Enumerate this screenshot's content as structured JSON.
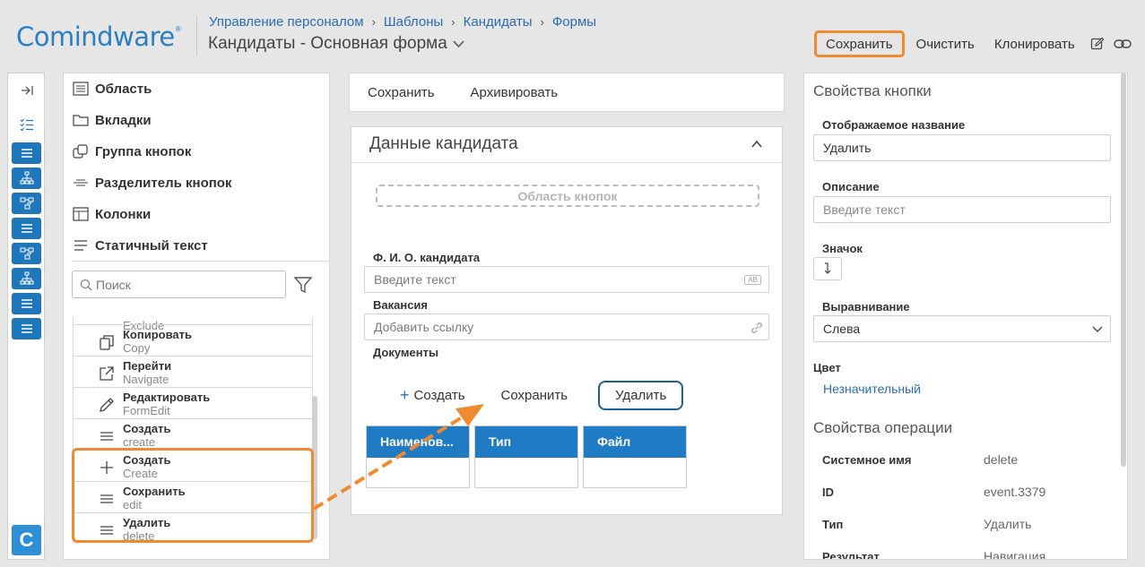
{
  "app": {
    "logo": "Comindware",
    "logo_mark": "®"
  },
  "breadcrumb": [
    "Управление персоналом",
    "Шаблоны",
    "Кандидаты",
    "Формы"
  ],
  "form_title": "Кандидаты - Основная форма",
  "top_actions": {
    "save": "Сохранить",
    "clear": "Очистить",
    "clone": "Клонировать"
  },
  "rail": {
    "logo_letter": "C"
  },
  "toolbox": {
    "categories": [
      "Область",
      "Вкладки",
      "Группа кнопок",
      "Разделитель кнопок",
      "Колонки",
      "Статичный текст"
    ],
    "search_placeholder": "Поиск",
    "items": [
      {
        "name": "",
        "sub": "Exclude"
      },
      {
        "name": "Копировать",
        "sub": "Copy"
      },
      {
        "name": "Перейти",
        "sub": "Navigate"
      },
      {
        "name": "Редактировать",
        "sub": "FormEdit"
      },
      {
        "name": "Создать",
        "sub": "create"
      },
      {
        "name": "Создать",
        "sub": "Create"
      },
      {
        "name": "Сохранить",
        "sub": "edit"
      },
      {
        "name": "Удалить",
        "sub": "delete"
      }
    ]
  },
  "form_toolbar": {
    "save": "Сохранить",
    "archive": "Архивировать"
  },
  "section": {
    "title": "Данные кандидата",
    "button_area": "Область кнопок",
    "fio_label": "Ф. И. О. кандидата",
    "fio_placeholder": "Введите текст",
    "fio_badge": "AB",
    "vacancy_label": "Вакансия",
    "vacancy_placeholder": "Добавить ссылку",
    "docs_label": "Документы",
    "doc_actions": {
      "create": "Создать",
      "save": "Сохранить",
      "delete": "Удалить"
    },
    "table_headers": [
      "Наименов...",
      "Тип",
      "Файл"
    ]
  },
  "button_props": {
    "title": "Свойства кнопки",
    "display_name_label": "Отображаемое название",
    "display_name_value": "Удалить",
    "description_label": "Описание",
    "description_placeholder": "Введите текст",
    "icon_label": "Значок",
    "align_label": "Выравнивание",
    "align_value": "Слева",
    "color_label": "Цвет",
    "color_value": "Незначительный"
  },
  "operation_props": {
    "title": "Свойства операции",
    "rows": [
      {
        "key": "Системное имя",
        "value": "delete"
      },
      {
        "key": "ID",
        "value": "event.3379"
      },
      {
        "key": "Тип",
        "value": "Удалить"
      },
      {
        "key": "Результат",
        "value": "Навигация"
      }
    ]
  },
  "colors": {
    "accent": "#1e76bb",
    "highlight": "#f08a30",
    "link": "#2a6db3"
  }
}
